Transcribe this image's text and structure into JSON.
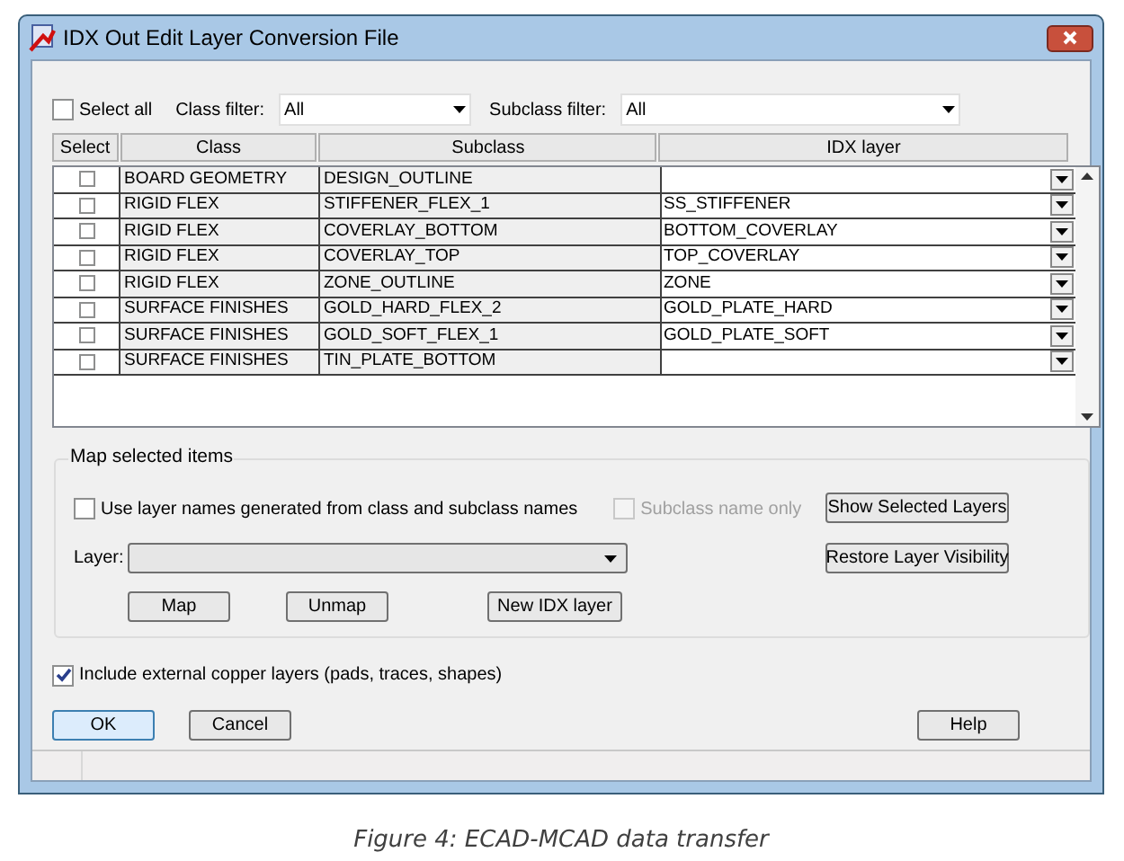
{
  "window": {
    "title": "IDX Out Edit Layer Conversion File"
  },
  "filters": {
    "select_all": {
      "label": "Select all",
      "checked": false
    },
    "class_filter": {
      "label": "Class filter:",
      "value": "All"
    },
    "subclass_filter": {
      "label": "Subclass filter:",
      "value": "All"
    }
  },
  "table": {
    "columns": [
      "Select",
      "Class",
      "Subclass",
      "IDX layer"
    ],
    "rows": [
      {
        "checked": false,
        "class": "BOARD GEOMETRY",
        "subclass": "DESIGN_OUTLINE",
        "idx_layer": ""
      },
      {
        "checked": false,
        "class": "RIGID FLEX",
        "subclass": "STIFFENER_FLEX_1",
        "idx_layer": "SS_STIFFENER"
      },
      {
        "checked": false,
        "class": "RIGID FLEX",
        "subclass": "COVERLAY_BOTTOM",
        "idx_layer": "BOTTOM_COVERLAY"
      },
      {
        "checked": false,
        "class": "RIGID FLEX",
        "subclass": "COVERLAY_TOP",
        "idx_layer": "TOP_COVERLAY"
      },
      {
        "checked": false,
        "class": "RIGID FLEX",
        "subclass": "ZONE_OUTLINE",
        "idx_layer": "ZONE"
      },
      {
        "checked": false,
        "class": "SURFACE FINISHES",
        "subclass": "GOLD_HARD_FLEX_2",
        "idx_layer": "GOLD_PLATE_HARD"
      },
      {
        "checked": false,
        "class": "SURFACE FINISHES",
        "subclass": "GOLD_SOFT_FLEX_1",
        "idx_layer": "GOLD_PLATE_SOFT"
      },
      {
        "checked": false,
        "class": "SURFACE FINISHES",
        "subclass": "TIN_PLATE_BOTTOM",
        "idx_layer": ""
      }
    ]
  },
  "map_group": {
    "title": "Map selected items",
    "use_names": {
      "label": "Use layer names generated from class and subclass names",
      "checked": false
    },
    "subclass_only": {
      "label": "Subclass name only",
      "checked": false,
      "disabled": true
    },
    "layer_label": "Layer:",
    "buttons": [
      "Map",
      "Unmap",
      "New IDX layer"
    ],
    "side_buttons": [
      "Show Selected Layers",
      "Restore Layer Visibility"
    ]
  },
  "include_copper": {
    "label": "Include external copper layers (pads, traces, shapes)",
    "checked": true
  },
  "buttons": [
    {
      "label": "OK",
      "default": true
    },
    {
      "label": "Cancel",
      "default": false
    },
    {
      "label": "Help",
      "default": false
    }
  ],
  "caption": "Figure 4: ECAD-MCAD data transfer"
}
